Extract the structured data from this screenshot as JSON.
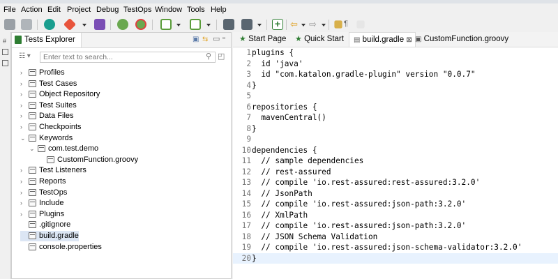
{
  "menubar": {
    "items": [
      "File",
      "Action",
      "Edit",
      "Project",
      "Debug",
      "TestOps",
      "Window",
      "Tools",
      "Help"
    ]
  },
  "toolbar": {
    "icons": [
      "save-icon",
      "save-all-icon",
      "katalon-icon",
      "git-icon",
      "kobiton-icon",
      "spy-web-icon",
      "record-web-icon",
      "spy-mobile-icon",
      "record-mobile-icon",
      "run-icon",
      "new-test-case-icon",
      "back-icon",
      "forward-icon",
      "toggle-icon",
      "pilcrow-icon",
      "whitespace-icon"
    ]
  },
  "explorer": {
    "title": "Tests Explorer",
    "search_placeholder": "Enter text to search...",
    "items": [
      {
        "label": "Profiles",
        "indent": 0,
        "expanded": false,
        "icon": "profile-folder-icon"
      },
      {
        "label": "Test Cases",
        "indent": 0,
        "expanded": false,
        "icon": "test-cases-folder-icon"
      },
      {
        "label": "Object Repository",
        "indent": 0,
        "expanded": false,
        "icon": "object-repository-folder-icon"
      },
      {
        "label": "Test Suites",
        "indent": 0,
        "expanded": false,
        "icon": "test-suites-folder-icon"
      },
      {
        "label": "Data Files",
        "indent": 0,
        "expanded": false,
        "icon": "data-files-folder-icon"
      },
      {
        "label": "Checkpoints",
        "indent": 0,
        "expanded": false,
        "icon": "checkpoints-folder-icon"
      },
      {
        "label": "Keywords",
        "indent": 0,
        "expanded": true,
        "icon": "keywords-folder-icon"
      },
      {
        "label": "com.test.demo",
        "indent": 1,
        "expanded": true,
        "icon": "package-icon"
      },
      {
        "label": "CustomFunction.groovy",
        "indent": 2,
        "expanded": null,
        "icon": "groovy-file-icon"
      },
      {
        "label": "Test Listeners",
        "indent": 0,
        "expanded": false,
        "icon": "test-listeners-folder-icon"
      },
      {
        "label": "Reports",
        "indent": 0,
        "expanded": false,
        "icon": "reports-folder-icon"
      },
      {
        "label": "TestOps",
        "indent": 0,
        "expanded": false,
        "icon": "testops-icon"
      },
      {
        "label": "Include",
        "indent": 0,
        "expanded": false,
        "icon": "include-folder-icon"
      },
      {
        "label": "Plugins",
        "indent": 0,
        "expanded": false,
        "icon": "plugins-folder-icon"
      },
      {
        "label": ".gitignore",
        "indent": 0,
        "expanded": null,
        "icon": "git-file-icon"
      },
      {
        "label": "build.gradle",
        "indent": 0,
        "expanded": null,
        "icon": "gradle-file-icon",
        "selected": true
      },
      {
        "label": "console.properties",
        "indent": 0,
        "expanded": null,
        "icon": "properties-file-icon"
      }
    ]
  },
  "editor": {
    "tabs": [
      {
        "label": "Start Page",
        "icon": "star-icon",
        "active": false
      },
      {
        "label": "Quick Start",
        "icon": "star-icon",
        "active": false
      },
      {
        "label": "build.gradle",
        "icon": "file-icon",
        "active": true,
        "close": "⊠"
      },
      {
        "label": "CustomFunction.groovy",
        "icon": "groovy-file-icon",
        "active": false
      }
    ],
    "lines": [
      "plugins {",
      "  id 'java'",
      "  id \"com.katalon.gradle-plugin\" version \"0.0.7\"",
      "}",
      "",
      "repositories {",
      "  mavenCentral()",
      "}",
      "",
      "dependencies {",
      "  // sample dependencies",
      "  // rest-assured",
      "  // compile 'io.rest-assured:rest-assured:3.2.0'",
      "  // JsonPath",
      "  // compile 'io.rest-assured:json-path:3.2.0'",
      "  // XmlPath",
      "  // compile 'io.rest-assured:json-path:3.2.0'",
      "  // JSON Schema Validation",
      "  // compile 'io.rest-assured:json-schema-validator:3.2.0'",
      "}"
    ],
    "current_line": 20
  },
  "colors": {
    "accent_green": "#2e7d32",
    "selection": "#dce6f4",
    "current_line": "#e8f2fe"
  }
}
